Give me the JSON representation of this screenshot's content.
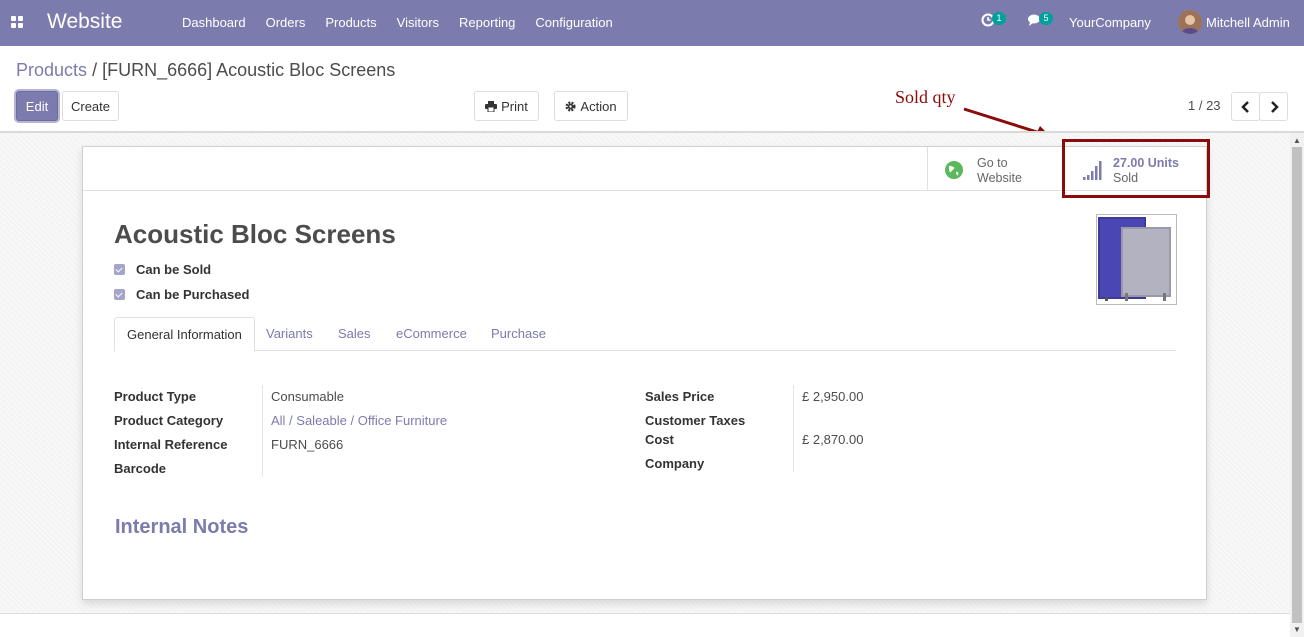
{
  "navbar": {
    "app_title": "Website",
    "menu": [
      "Dashboard",
      "Orders",
      "Products",
      "Visitors",
      "Reporting",
      "Configuration"
    ],
    "activity_badge": "1",
    "messages_badge": "5",
    "company": "YourCompany",
    "user": "Mitchell Admin",
    "color": "#7c7bad"
  },
  "breadcrumb": {
    "parent": "Products",
    "separator": "/",
    "current": "[FURN_6666] Acoustic Bloc Screens"
  },
  "toolbar": {
    "edit": "Edit",
    "create": "Create",
    "print": "Print",
    "action": "Action",
    "pager": "1 / 23"
  },
  "smart_buttons": {
    "website_line1": "Go to",
    "website_line2": "Website",
    "sold_value": "27.00 Units",
    "sold_label": "Sold"
  },
  "product": {
    "name": "Acoustic Bloc Screens",
    "can_be_sold_label": "Can be Sold",
    "can_be_sold": true,
    "can_be_purchased_label": "Can be Purchased",
    "can_be_purchased": true
  },
  "tabs": [
    "General Information",
    "Variants",
    "Sales",
    "eCommerce",
    "Purchase"
  ],
  "general": {
    "left": [
      {
        "label": "Product Type",
        "value": "Consumable"
      },
      {
        "label": "Product Category",
        "value": "All / Saleable / Office Furniture"
      },
      {
        "label": "Internal Reference",
        "value": "FURN_6666"
      },
      {
        "label": "Barcode",
        "value": ""
      }
    ],
    "right": [
      {
        "label": "Sales Price",
        "value": "£ 2,950.00"
      },
      {
        "label": "Customer Taxes",
        "value": ""
      },
      {
        "label": "Cost",
        "value": "£ 2,870.00"
      },
      {
        "label": "Company",
        "value": ""
      }
    ]
  },
  "internal_notes_title": "Internal Notes",
  "annotation": {
    "text": "Sold qty",
    "color": "#8b0a0a"
  }
}
